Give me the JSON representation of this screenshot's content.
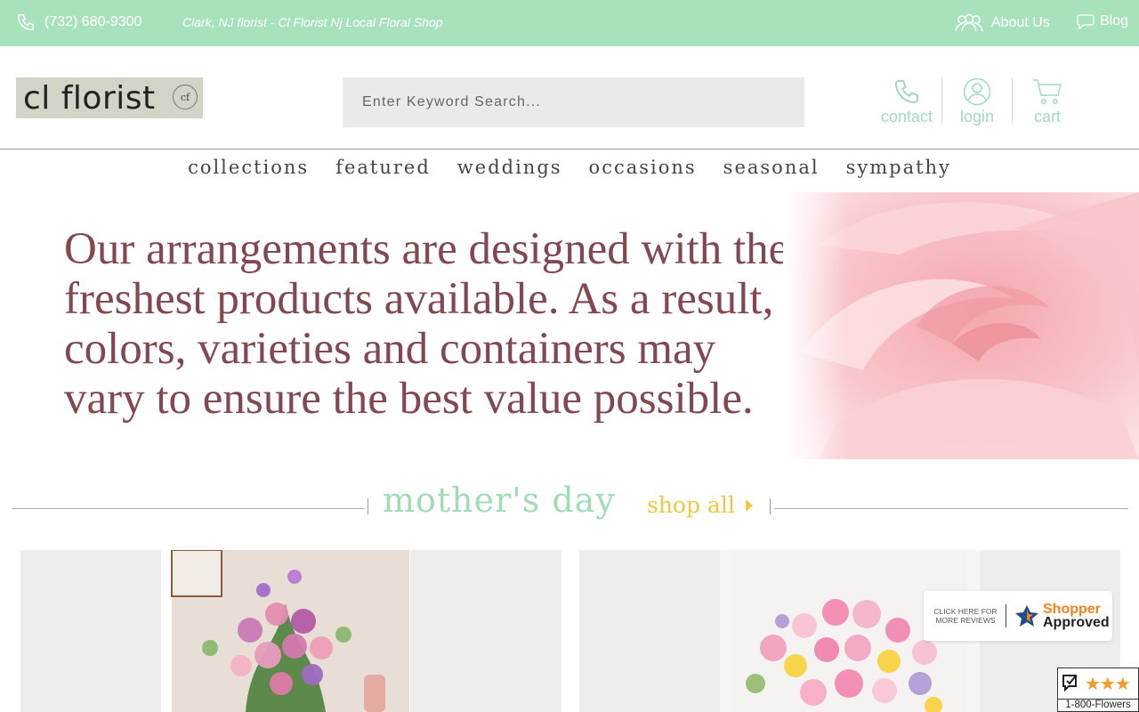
{
  "topbar": {
    "phone": "(732) 680-9300",
    "tagline": "Clark, NJ florist - Cl Florist Nj Local Floral Shop",
    "about_label": "About Us",
    "blog_label": "Blog"
  },
  "header": {
    "logo_text": "cl florist",
    "logo_badge": "cf",
    "search_placeholder": "Enter Keyword Search...",
    "actions": [
      {
        "label": "contact",
        "icon": "phone-icon"
      },
      {
        "label": "login",
        "icon": "user-icon"
      },
      {
        "label": "cart",
        "icon": "cart-icon"
      }
    ]
  },
  "nav": [
    "collections",
    "featured",
    "weddings",
    "occasions",
    "seasonal",
    "sympathy"
  ],
  "hero": {
    "text": "Our arrangements are designed with the freshest products available. As a result, colors, varieties and containers may vary to ensure the best value possible."
  },
  "section": {
    "title": "mother's day",
    "shop_all": "shop all"
  },
  "badges": {
    "shopper_click": "CLICK HERE FOR MORE REVIEWS",
    "shopper_word1": "Shopper",
    "shopper_word2": "Approved",
    "reviews_label": "1-800-Flowers"
  },
  "colors": {
    "topbar": "#a8e2bc",
    "accent_green": "#a0dcb4",
    "hero_text": "#83474f",
    "shop_all": "#f2c840"
  }
}
